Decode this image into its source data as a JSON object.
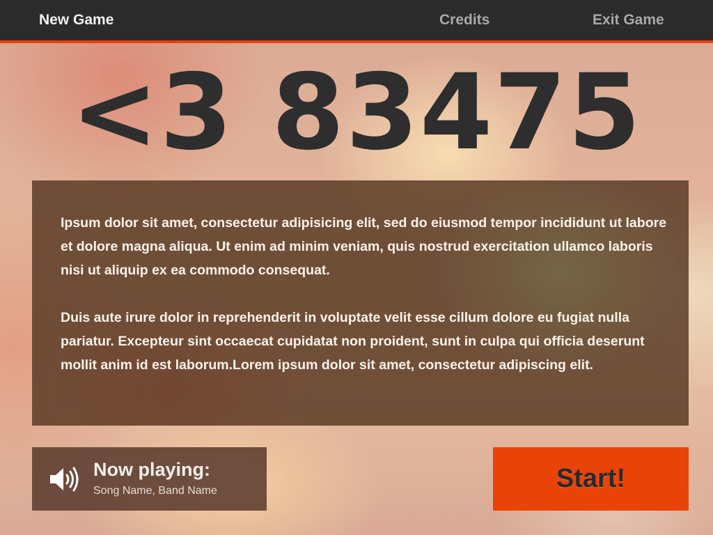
{
  "nav": {
    "new_game": "New Game",
    "credits": "Credits",
    "exit_game": "Exit Game"
  },
  "score": {
    "value": "<3 83475"
  },
  "description": {
    "paragraph_1": " Ipsum dolor sit amet, consectetur adipisicing elit, sed do eiusmod tempor incididunt ut labore et dolore magna aliqua. Ut enim ad minim veniam, quis nostrud exercitation ullamco laboris nisi ut aliquip ex ea commodo consequat.",
    "paragraph_2": "Duis aute irure dolor in reprehenderit in voluptate velit esse cillum dolore eu fugiat nulla pariatur. Excepteur sint occaecat cupidatat non proident, sunt in culpa qui officia deserunt mollit anim id est laborum.Lorem ipsum dolor sit amet, consectetur adipiscing elit."
  },
  "now_playing": {
    "title": "Now playing:",
    "song": "Song Name, Band Name",
    "icon": "speaker-icon"
  },
  "start_button": {
    "label": "Start!"
  },
  "colors": {
    "accent": "#e5430d",
    "topbar": "#2b2b2b",
    "score_text": "#2e2e2e"
  }
}
